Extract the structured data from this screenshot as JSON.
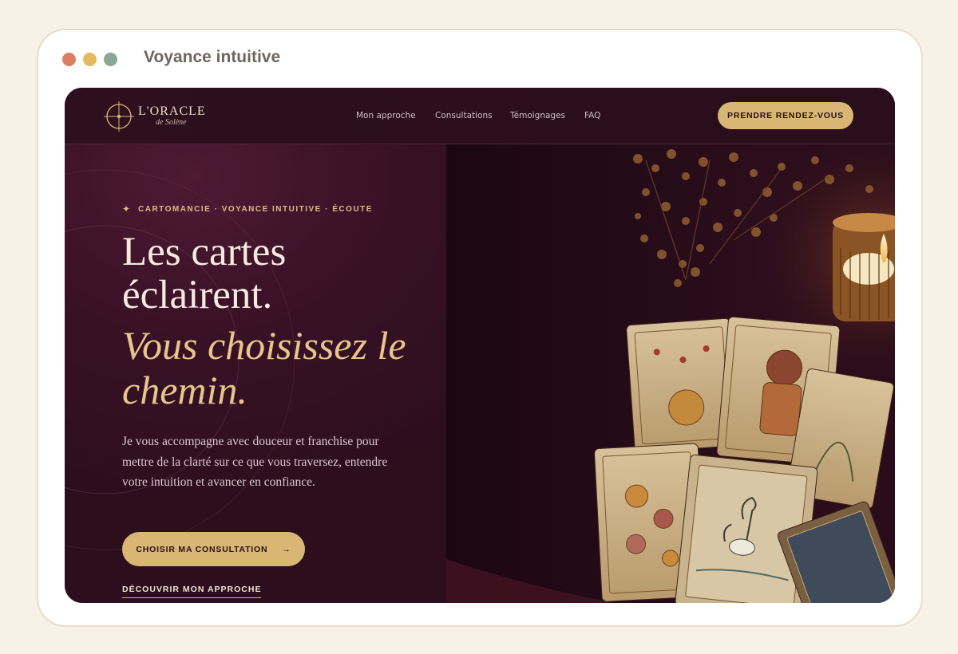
{
  "window": {
    "title": "Voyance intuitive"
  },
  "nav": {
    "brand_name": "L'ORACLE",
    "brand_sub": "de Solène",
    "links": [
      "Mon approche",
      "Consultations",
      "Témoignages",
      "FAQ"
    ],
    "cta_label": "PRENDRE RENDEZ-VOUS"
  },
  "hero": {
    "kicker_star": "✦",
    "kicker": "CARTOMANCIE · VOYANCE INTUITIVE · ÉCOUTE",
    "headline_line1": "Les cartes",
    "headline_line2": "éclairent.",
    "headline_em_line1": "Vous choisissez le",
    "headline_em_line2": "chemin.",
    "lead": "Je vous accompagne avec douceur et franchise pour mettre de la clarté sur ce que vous traversez, entendre votre intuition et avancer en confiance.",
    "cta_label": "CHOISIR MA CONSULTATION",
    "cta_arrow": "→",
    "secondary_link": "DÉCOUVRIR MON APPROCHE"
  },
  "colors": {
    "accent_gold": "#d8b774",
    "background_plum": "#2c0f1d",
    "headline_cream": "#f4ebdf",
    "italic_gold": "#e6c68a"
  },
  "icons": {
    "logo": "compass-star-icon",
    "window_controls": [
      "close-dot",
      "minimize-dot",
      "maximize-dot"
    ]
  }
}
